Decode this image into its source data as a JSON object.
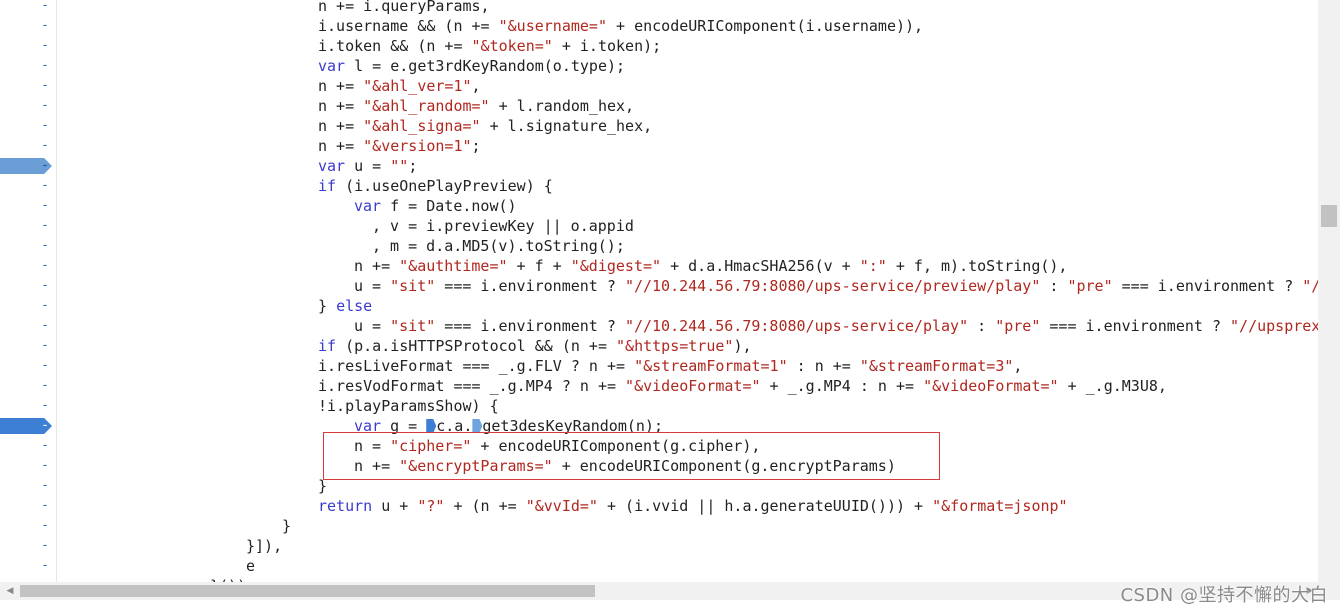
{
  "gutter": {
    "fold_glyph": "-",
    "breakpoints": [
      {
        "line_index": 8,
        "style": "light"
      },
      {
        "line_index": 21,
        "style": "dark"
      }
    ]
  },
  "code_lines": [
    {
      "indent": 32,
      "tokens": [
        [
          "t",
          "n += i.queryParams,"
        ]
      ]
    },
    {
      "indent": 32,
      "tokens": [
        [
          "t",
          "i.username && (n += "
        ],
        [
          "s",
          "\"&username=\""
        ],
        [
          "t",
          " + encodeURIComponent(i.username)),"
        ]
      ]
    },
    {
      "indent": 32,
      "tokens": [
        [
          "t",
          "i.token && (n += "
        ],
        [
          "s",
          "\"&token=\""
        ],
        [
          "t",
          " + i.token);"
        ]
      ]
    },
    {
      "indent": 32,
      "tokens": [
        [
          "k",
          "var"
        ],
        [
          "t",
          " l = e.get3rdKeyRandom(o.type);"
        ]
      ]
    },
    {
      "indent": 32,
      "tokens": [
        [
          "t",
          "n += "
        ],
        [
          "s",
          "\"&ahl_ver=1\""
        ],
        [
          "t",
          ","
        ]
      ]
    },
    {
      "indent": 32,
      "tokens": [
        [
          "t",
          "n += "
        ],
        [
          "s",
          "\"&ahl_random=\""
        ],
        [
          "t",
          " + l.random_hex,"
        ]
      ]
    },
    {
      "indent": 32,
      "tokens": [
        [
          "t",
          "n += "
        ],
        [
          "s",
          "\"&ahl_signa=\""
        ],
        [
          "t",
          " + l.signature_hex,"
        ]
      ]
    },
    {
      "indent": 32,
      "tokens": [
        [
          "t",
          "n += "
        ],
        [
          "s",
          "\"&version=1\""
        ],
        [
          "t",
          ";"
        ]
      ]
    },
    {
      "indent": 32,
      "tokens": [
        [
          "k",
          "var"
        ],
        [
          "t",
          " u = "
        ],
        [
          "s",
          "\"\""
        ],
        [
          "t",
          ";"
        ]
      ]
    },
    {
      "indent": 32,
      "tokens": [
        [
          "k",
          "if"
        ],
        [
          "t",
          " (i.useOnePlayPreview) {"
        ]
      ]
    },
    {
      "indent": 36,
      "tokens": [
        [
          "k",
          "var"
        ],
        [
          "t",
          " f = Date.now()"
        ]
      ]
    },
    {
      "indent": 38,
      "tokens": [
        [
          "t",
          ", v = i.previewKey || o.appid"
        ]
      ]
    },
    {
      "indent": 38,
      "tokens": [
        [
          "t",
          ", m = d.a.MD5(v).toString();"
        ]
      ]
    },
    {
      "indent": 36,
      "tokens": [
        [
          "t",
          "n += "
        ],
        [
          "s",
          "\"&authtime=\""
        ],
        [
          "t",
          " + f + "
        ],
        [
          "s",
          "\"&digest=\""
        ],
        [
          "t",
          " + d.a.HmacSHA256(v + "
        ],
        [
          "s",
          "\":\""
        ],
        [
          "t",
          " + f, m).toString(),"
        ]
      ]
    },
    {
      "indent": 36,
      "tokens": [
        [
          "t",
          "u = "
        ],
        [
          "s",
          "\"sit\""
        ],
        [
          "t",
          " === i.environment ? "
        ],
        [
          "s",
          "\"//10.244.56.79:8080/ups-service/preview/play\""
        ],
        [
          "t",
          " : "
        ],
        [
          "s",
          "\"pre\""
        ],
        [
          "t",
          " === i.environment ? "
        ],
        [
          "s",
          "\"/"
        ]
      ]
    },
    {
      "indent": 32,
      "tokens": [
        [
          "t",
          "} "
        ],
        [
          "k",
          "else"
        ]
      ]
    },
    {
      "indent": 36,
      "tokens": [
        [
          "t",
          "u = "
        ],
        [
          "s",
          "\"sit\""
        ],
        [
          "t",
          " === i.environment ? "
        ],
        [
          "s",
          "\"//10.244.56.79:8080/ups-service/play\""
        ],
        [
          "t",
          " : "
        ],
        [
          "s",
          "\"pre\""
        ],
        [
          "t",
          " === i.environment ? "
        ],
        [
          "s",
          "\"//upsprex"
        ]
      ]
    },
    {
      "indent": 32,
      "tokens": [
        [
          "k",
          "if"
        ],
        [
          "t",
          " (p.a.isHTTPSProtocol && (n += "
        ],
        [
          "s",
          "\"&https=true\""
        ],
        [
          "t",
          "),"
        ]
      ]
    },
    {
      "indent": 32,
      "tokens": [
        [
          "t",
          "i.resLiveFormat === _.g.FLV ? n += "
        ],
        [
          "s",
          "\"&streamFormat=1\""
        ],
        [
          "t",
          " : n += "
        ],
        [
          "s",
          "\"&streamFormat=3\""
        ],
        [
          "t",
          ","
        ]
      ]
    },
    {
      "indent": 32,
      "tokens": [
        [
          "t",
          "i.resVodFormat === _.g.MP4 ? n += "
        ],
        [
          "s",
          "\"&videoFormat=\""
        ],
        [
          "t",
          " + _.g.MP4 : n += "
        ],
        [
          "s",
          "\"&videoFormat=\""
        ],
        [
          "t",
          " + _.g.M3U8,"
        ]
      ]
    },
    {
      "indent": 32,
      "tokens": [
        [
          "t",
          "!i.playParamsShow) {"
        ]
      ]
    },
    {
      "indent": 36,
      "tokens": [
        [
          "k",
          "var"
        ],
        [
          "t",
          " g = "
        ],
        [
          "m",
          "solid"
        ],
        [
          "t",
          "c.a."
        ],
        [
          "m",
          "outline"
        ],
        [
          "t",
          "get3desKeyRandom(n);"
        ]
      ]
    },
    {
      "indent": 36,
      "tokens": [
        [
          "t",
          "n = "
        ],
        [
          "s",
          "\"cipher=\""
        ],
        [
          "t",
          " + encodeURIComponent(g.cipher),"
        ]
      ]
    },
    {
      "indent": 36,
      "tokens": [
        [
          "t",
          "n += "
        ],
        [
          "s",
          "\"&encryptParams=\""
        ],
        [
          "t",
          " + encodeURIComponent(g.encryptParams)"
        ]
      ]
    },
    {
      "indent": 32,
      "tokens": [
        [
          "t",
          "}"
        ]
      ]
    },
    {
      "indent": 32,
      "tokens": [
        [
          "k",
          "return"
        ],
        [
          "t",
          " u + "
        ],
        [
          "s",
          "\"?\""
        ],
        [
          "t",
          " + (n += "
        ],
        [
          "s",
          "\"&vvId=\""
        ],
        [
          "t",
          " + (i.vvid || h.a.generateUUID())) + "
        ],
        [
          "s",
          "\"&format=jsonp\""
        ]
      ]
    },
    {
      "indent": 28,
      "tokens": [
        [
          "t",
          "}"
        ]
      ]
    },
    {
      "indent": 24,
      "tokens": [
        [
          "t",
          "}]),"
        ]
      ]
    },
    {
      "indent": 24,
      "tokens": [
        [
          "t",
          "e"
        ]
      ]
    },
    {
      "indent": 20,
      "tokens": [
        [
          "t",
          "}());"
        ]
      ]
    }
  ],
  "watermark": "CSDN @坚持不懈的大白",
  "scrollbars": {
    "left_arrow": "◀",
    "right_arrow": "▶"
  },
  "colors": {
    "keyword": "#3a3acf",
    "string": "#b0281f",
    "text": "#222222",
    "highlight_box": "#d83a3a",
    "breakpoint": "#3c7fd4"
  }
}
